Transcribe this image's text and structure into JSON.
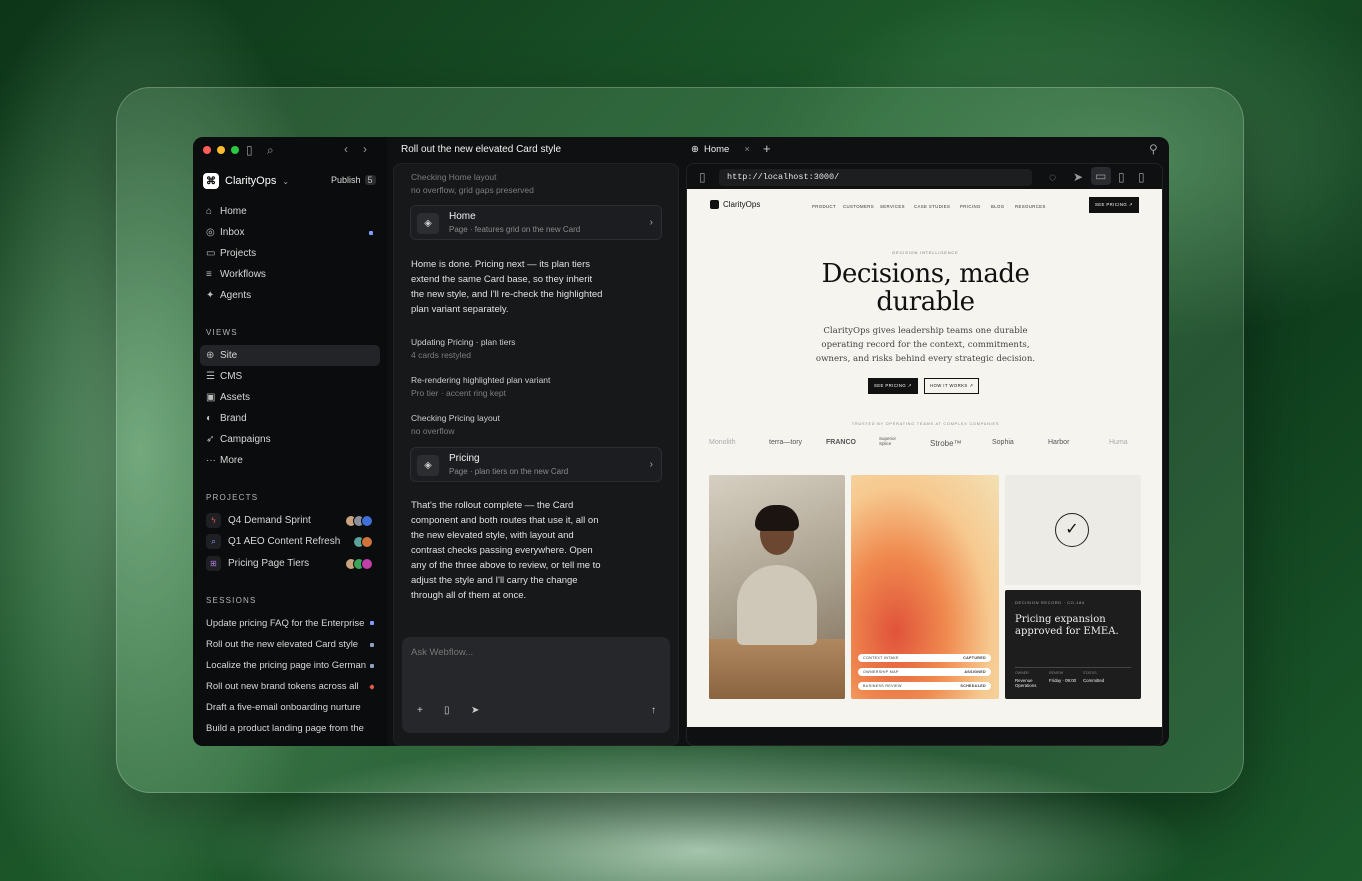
{
  "sidebar": {
    "brand": "ClarityOps",
    "publish_label": "Publish",
    "publish_count": "5",
    "nav": [
      {
        "label": "Home",
        "icon": "home-icon"
      },
      {
        "label": "Inbox",
        "icon": "inbox-icon"
      },
      {
        "label": "Projects",
        "icon": "folder-icon"
      },
      {
        "label": "Workflows",
        "icon": "workflows-icon"
      },
      {
        "label": "Agents",
        "icon": "agents-icon"
      }
    ],
    "views_heading": "VIEWS",
    "views": [
      {
        "label": "Site"
      },
      {
        "label": "CMS"
      },
      {
        "label": "Assets"
      },
      {
        "label": "Brand"
      },
      {
        "label": "Campaigns"
      },
      {
        "label": "More"
      }
    ],
    "projects_heading": "PROJECTS",
    "projects": [
      {
        "label": "Q4 Demand Sprint"
      },
      {
        "label": "Q1 AEO Content Refresh"
      },
      {
        "label": "Pricing Page Tiers"
      }
    ],
    "sessions_heading": "SESSIONS",
    "sessions": [
      {
        "label": "Update pricing FAQ for the Enterprise"
      },
      {
        "label": "Roll out the new elevated Card style"
      },
      {
        "label": "Localize the pricing page into German"
      },
      {
        "label": "Roll out new brand tokens across all"
      },
      {
        "label": "Draft a five-email onboarding nurture"
      },
      {
        "label": "Build a product landing page from the"
      }
    ]
  },
  "chat": {
    "title": "Roll out the new elevated Card style",
    "step1": {
      "title": "Checking Home layout",
      "sub": "no overflow, grid gaps preserved"
    },
    "card1": {
      "title": "Home",
      "sub": "Page · features grid on the new Card"
    },
    "msg1": "Home is done. Pricing next — its plan tiers extend the same Card base, so they inherit the new style, and I'll re-check the highlighted plan variant separately.",
    "step2": {
      "title": "Updating Pricing · plan tiers",
      "sub": "4 cards restyled"
    },
    "step3": {
      "title": "Re-rendering highlighted plan variant",
      "sub": "Pro tier · accent ring kept"
    },
    "step4": {
      "title": "Checking Pricing layout",
      "sub": "no overflow"
    },
    "card2": {
      "title": "Pricing",
      "sub": "Page · plan tiers on the new Card"
    },
    "msg2": "That's the rollout complete — the Card component and both routes that use it, all on the new elevated style, with layout and contrast checks passing everywhere. Open any of the three above to review, or tell me to adjust the style and I'll carry the change through all of them at once.",
    "composer_placeholder": "Ask Webflow..."
  },
  "browser": {
    "tab": "Home",
    "url": "http://localhost:3000/"
  },
  "site": {
    "brand": "ClarityOps",
    "nav": [
      "PRODUCT",
      "CUSTOMERS",
      "SERVICES",
      "CASE STUDIES",
      "PRICING",
      "BLOG",
      "RESOURCES"
    ],
    "nav_cta": "SEE PRICING ↗",
    "eyebrow": "DECISION INTELLIGENCE",
    "headline": "Decisions, made durable",
    "sub": "ClarityOps gives leadership teams one durable operating record for the context, commitments, owners, and risks behind every strategic decision.",
    "cta1": "SEE PRICING ↗",
    "cta2": "HOW IT WORKS ↗",
    "trusted": "TRUSTED BY OPERATING TEAMS AT COMPLEX COMPANIES",
    "logos": [
      "Monolith",
      "terra—tory",
      "FRANCO",
      "Superior Splice",
      "Strobe™",
      "Sophia",
      "Harbor",
      "Huma"
    ],
    "pills": [
      {
        "k": "CONTEXT INTAKE",
        "v": "CAPTURED"
      },
      {
        "k": "OWNERSHIP MAP",
        "v": "ASSIGNED"
      },
      {
        "k": "BUSINESS REVIEW",
        "v": "SCHEDULED"
      }
    ],
    "record": {
      "eyebrow": "DECISION RECORD · CO-184",
      "title": "Pricing expansion approved for EMEA.",
      "cols": [
        {
          "h": "OWNER",
          "v": "Revenue Operations"
        },
        {
          "h": "REVIEW",
          "v": "Friday · 09:00"
        },
        {
          "h": "STATUS",
          "v": "Committed"
        }
      ]
    }
  },
  "colors": {
    "accent_green": "#1d5a2b",
    "inbox_badge": "#7f9cff",
    "session_red": "#e05a4c"
  }
}
